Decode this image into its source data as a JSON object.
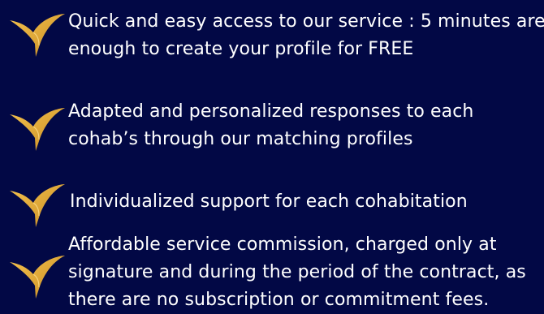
{
  "colors": {
    "background": "#020845",
    "text": "#ffffff",
    "icon_gold": "#e8b23c",
    "icon_gold_dark": "#c98d22"
  },
  "features": [
    {
      "icon": "golden-hummingbird-icon",
      "lines": [
        "Quick and easy access to our service : 5 minutes are",
        "enough to create your profile for FREE"
      ]
    },
    {
      "icon": "golden-hummingbird-icon",
      "lines": [
        "Adapted and personalized responses to each",
        "cohab’s through our matching profiles"
      ]
    },
    {
      "icon": "golden-hummingbird-icon",
      "lines": [
        "Individualized support for each cohabitation"
      ]
    },
    {
      "icon": "golden-hummingbird-icon",
      "lines": [
        "Affordable service commission, charged only at",
        "signature and during the period of  the contract, as",
        "there are no subscription or commitment fees."
      ]
    }
  ]
}
